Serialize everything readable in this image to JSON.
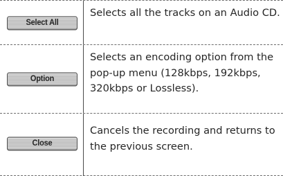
{
  "rows": [
    {
      "button_label": "Select All",
      "description": "Selects all the tracks on an Audio CD."
    },
    {
      "button_label": "Option",
      "description": "Selects an encoding option from the pop-up menu (128kbps, 192kbps, 320kbps or Lossless)."
    },
    {
      "button_label": "Close",
      "description": "Cancels the recording and returns to the previous screen."
    }
  ]
}
